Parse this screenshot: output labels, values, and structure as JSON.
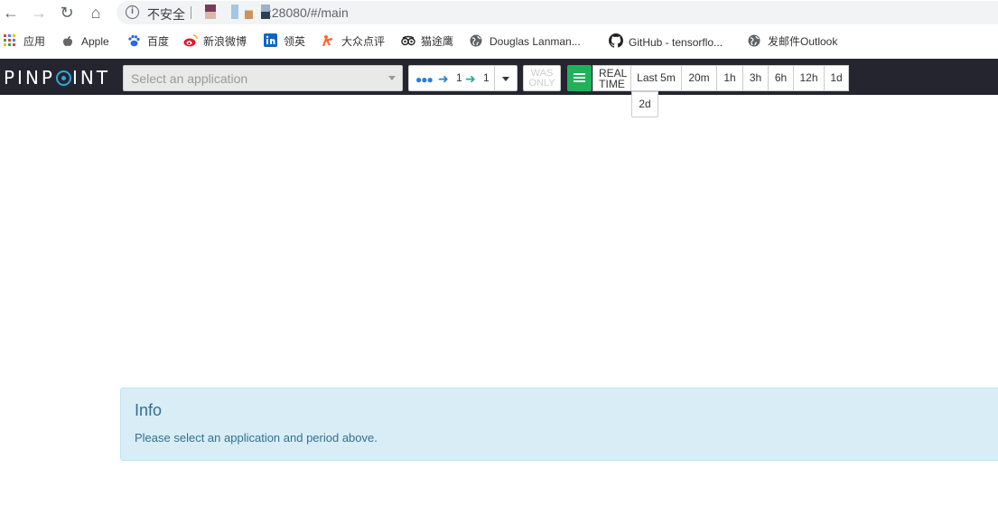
{
  "browser": {
    "security_label": "不安全",
    "url": ":28080/#/main",
    "bookmarks": [
      {
        "label": "应用",
        "icon": "apps-grid-icon"
      },
      {
        "label": "Apple",
        "icon": "apple-icon"
      },
      {
        "label": "百度",
        "icon": "baidu-paw-icon"
      },
      {
        "label": "新浪微博",
        "icon": "weibo-icon"
      },
      {
        "label": "领英",
        "icon": "linkedin-icon"
      },
      {
        "label": "大众点评",
        "icon": "dianping-icon"
      },
      {
        "label": "猫途鹰",
        "icon": "tripadvisor-owl-icon"
      },
      {
        "label": "Douglas Lanman...",
        "icon": "globe-icon"
      },
      {
        "label": "GitHub - tensorflo...",
        "icon": "github-icon"
      },
      {
        "label": "发邮件Outlook",
        "icon": "globe-icon"
      }
    ]
  },
  "navbar": {
    "logo": {
      "pre": "PINP",
      "post": "INT"
    },
    "app_select_placeholder": "Select an application",
    "depth": {
      "inbound": "1",
      "outbound": "1"
    },
    "was_only": {
      "line1": "WAS",
      "line2": "ONLY"
    },
    "realtime": {
      "line1": "REAL",
      "line2": "TIME"
    },
    "periods": [
      "Last 5m",
      "20m",
      "1h",
      "3h",
      "6h",
      "12h",
      "1d"
    ],
    "extra_period": "2d"
  },
  "info": {
    "title": "Info",
    "message": "Please select an application and period above."
  },
  "colors": {
    "navbar_bg": "#24252f",
    "logo_accent": "#2ea7e0",
    "list_button": "#1fb25a",
    "info_bg": "#d9edf7",
    "info_text": "#31708f"
  }
}
